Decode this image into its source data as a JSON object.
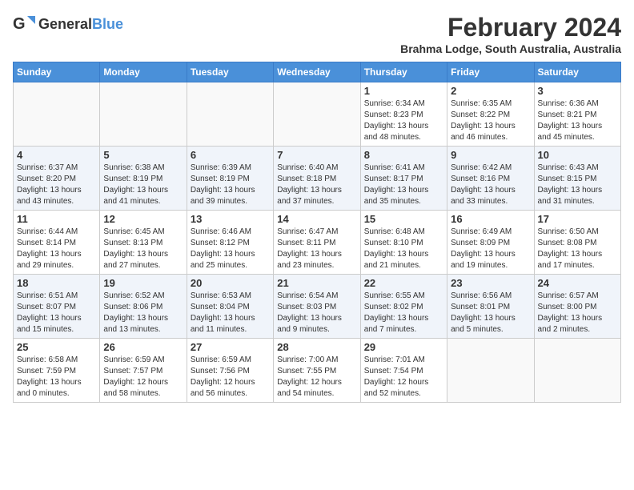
{
  "logo": {
    "general": "General",
    "blue": "Blue"
  },
  "title": "February 2024",
  "location": "Brahma Lodge, South Australia, Australia",
  "weekdays": [
    "Sunday",
    "Monday",
    "Tuesday",
    "Wednesday",
    "Thursday",
    "Friday",
    "Saturday"
  ],
  "weeks": [
    [
      {
        "day": "",
        "info": ""
      },
      {
        "day": "",
        "info": ""
      },
      {
        "day": "",
        "info": ""
      },
      {
        "day": "",
        "info": ""
      },
      {
        "day": "1",
        "info": "Sunrise: 6:34 AM\nSunset: 8:23 PM\nDaylight: 13 hours\nand 48 minutes."
      },
      {
        "day": "2",
        "info": "Sunrise: 6:35 AM\nSunset: 8:22 PM\nDaylight: 13 hours\nand 46 minutes."
      },
      {
        "day": "3",
        "info": "Sunrise: 6:36 AM\nSunset: 8:21 PM\nDaylight: 13 hours\nand 45 minutes."
      }
    ],
    [
      {
        "day": "4",
        "info": "Sunrise: 6:37 AM\nSunset: 8:20 PM\nDaylight: 13 hours\nand 43 minutes."
      },
      {
        "day": "5",
        "info": "Sunrise: 6:38 AM\nSunset: 8:19 PM\nDaylight: 13 hours\nand 41 minutes."
      },
      {
        "day": "6",
        "info": "Sunrise: 6:39 AM\nSunset: 8:19 PM\nDaylight: 13 hours\nand 39 minutes."
      },
      {
        "day": "7",
        "info": "Sunrise: 6:40 AM\nSunset: 8:18 PM\nDaylight: 13 hours\nand 37 minutes."
      },
      {
        "day": "8",
        "info": "Sunrise: 6:41 AM\nSunset: 8:17 PM\nDaylight: 13 hours\nand 35 minutes."
      },
      {
        "day": "9",
        "info": "Sunrise: 6:42 AM\nSunset: 8:16 PM\nDaylight: 13 hours\nand 33 minutes."
      },
      {
        "day": "10",
        "info": "Sunrise: 6:43 AM\nSunset: 8:15 PM\nDaylight: 13 hours\nand 31 minutes."
      }
    ],
    [
      {
        "day": "11",
        "info": "Sunrise: 6:44 AM\nSunset: 8:14 PM\nDaylight: 13 hours\nand 29 minutes."
      },
      {
        "day": "12",
        "info": "Sunrise: 6:45 AM\nSunset: 8:13 PM\nDaylight: 13 hours\nand 27 minutes."
      },
      {
        "day": "13",
        "info": "Sunrise: 6:46 AM\nSunset: 8:12 PM\nDaylight: 13 hours\nand 25 minutes."
      },
      {
        "day": "14",
        "info": "Sunrise: 6:47 AM\nSunset: 8:11 PM\nDaylight: 13 hours\nand 23 minutes."
      },
      {
        "day": "15",
        "info": "Sunrise: 6:48 AM\nSunset: 8:10 PM\nDaylight: 13 hours\nand 21 minutes."
      },
      {
        "day": "16",
        "info": "Sunrise: 6:49 AM\nSunset: 8:09 PM\nDaylight: 13 hours\nand 19 minutes."
      },
      {
        "day": "17",
        "info": "Sunrise: 6:50 AM\nSunset: 8:08 PM\nDaylight: 13 hours\nand 17 minutes."
      }
    ],
    [
      {
        "day": "18",
        "info": "Sunrise: 6:51 AM\nSunset: 8:07 PM\nDaylight: 13 hours\nand 15 minutes."
      },
      {
        "day": "19",
        "info": "Sunrise: 6:52 AM\nSunset: 8:06 PM\nDaylight: 13 hours\nand 13 minutes."
      },
      {
        "day": "20",
        "info": "Sunrise: 6:53 AM\nSunset: 8:04 PM\nDaylight: 13 hours\nand 11 minutes."
      },
      {
        "day": "21",
        "info": "Sunrise: 6:54 AM\nSunset: 8:03 PM\nDaylight: 13 hours\nand 9 minutes."
      },
      {
        "day": "22",
        "info": "Sunrise: 6:55 AM\nSunset: 8:02 PM\nDaylight: 13 hours\nand 7 minutes."
      },
      {
        "day": "23",
        "info": "Sunrise: 6:56 AM\nSunset: 8:01 PM\nDaylight: 13 hours\nand 5 minutes."
      },
      {
        "day": "24",
        "info": "Sunrise: 6:57 AM\nSunset: 8:00 PM\nDaylight: 13 hours\nand 2 minutes."
      }
    ],
    [
      {
        "day": "25",
        "info": "Sunrise: 6:58 AM\nSunset: 7:59 PM\nDaylight: 13 hours\nand 0 minutes."
      },
      {
        "day": "26",
        "info": "Sunrise: 6:59 AM\nSunset: 7:57 PM\nDaylight: 12 hours\nand 58 minutes."
      },
      {
        "day": "27",
        "info": "Sunrise: 6:59 AM\nSunset: 7:56 PM\nDaylight: 12 hours\nand 56 minutes."
      },
      {
        "day": "28",
        "info": "Sunrise: 7:00 AM\nSunset: 7:55 PM\nDaylight: 12 hours\nand 54 minutes."
      },
      {
        "day": "29",
        "info": "Sunrise: 7:01 AM\nSunset: 7:54 PM\nDaylight: 12 hours\nand 52 minutes."
      },
      {
        "day": "",
        "info": ""
      },
      {
        "day": "",
        "info": ""
      }
    ]
  ]
}
